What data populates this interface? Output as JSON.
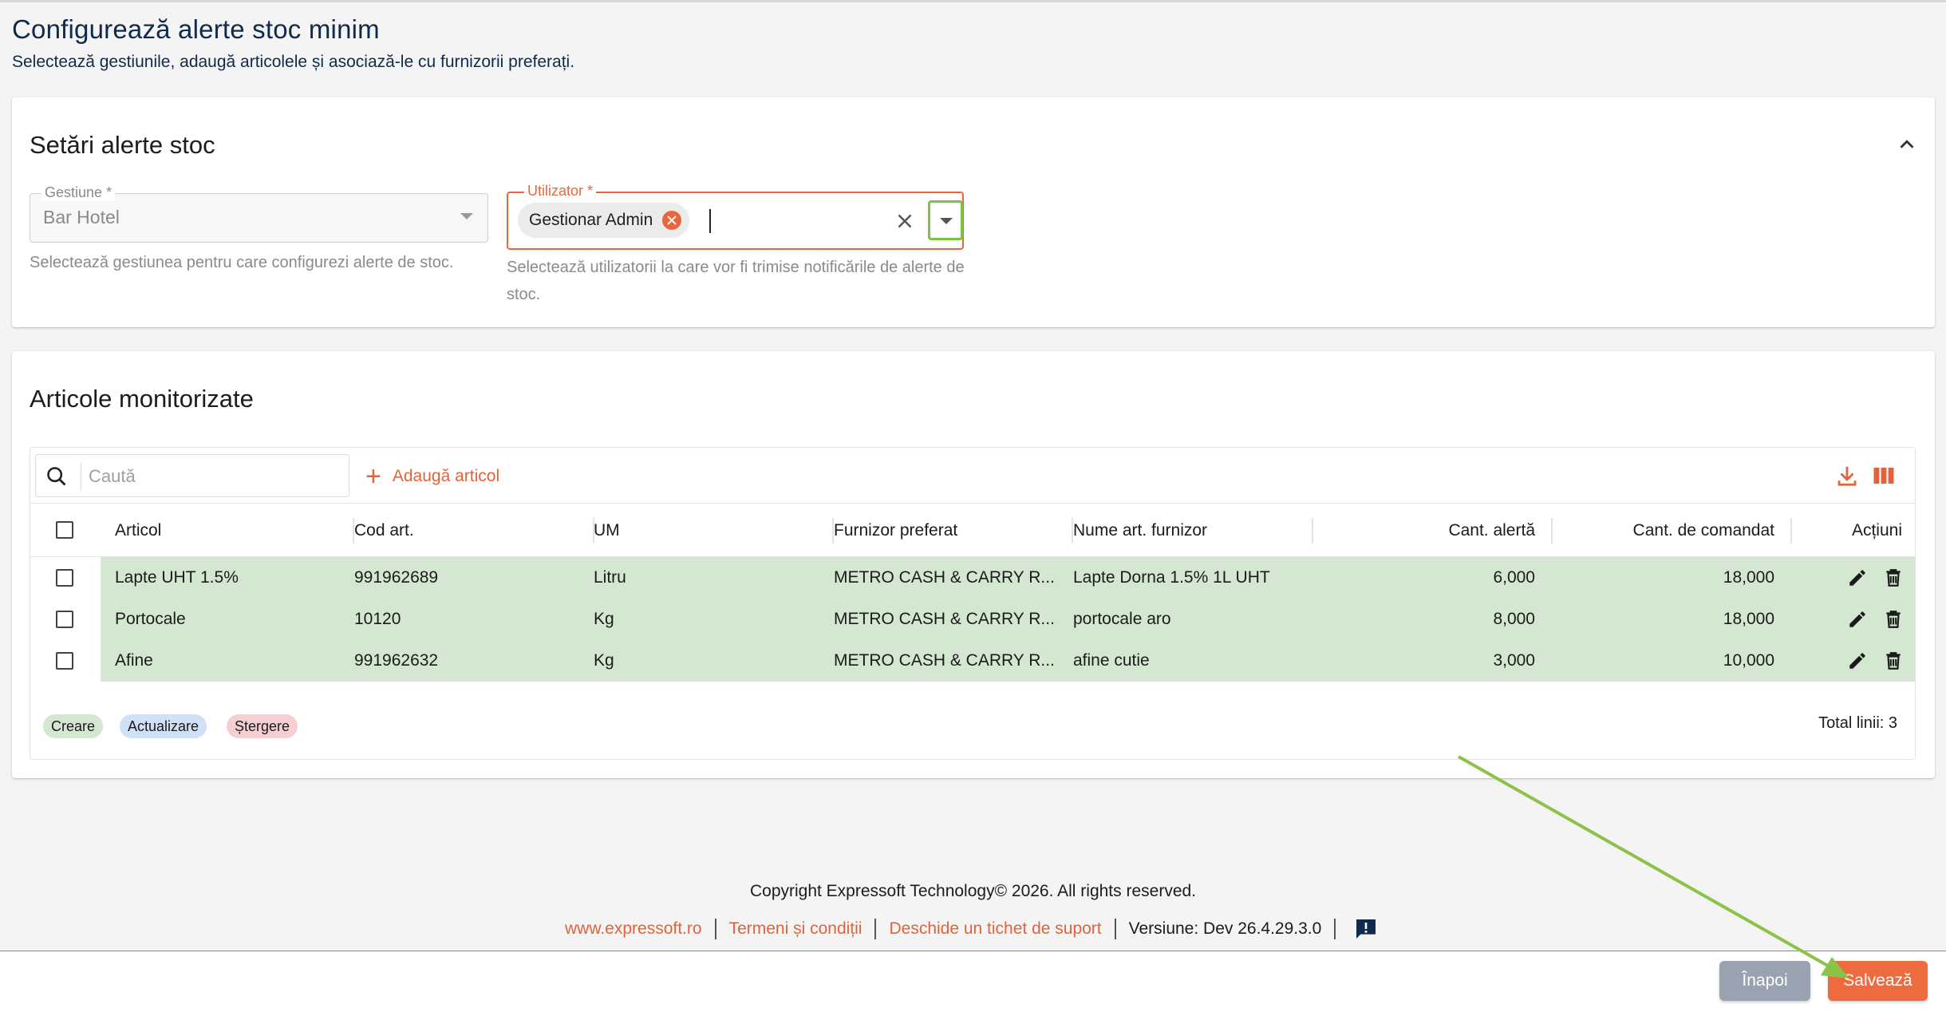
{
  "page": {
    "title": "Configurează alerte stoc minim",
    "subtitle": "Selectează gestiunile, adaugă articolele și asociază-le cu furnizorii preferați."
  },
  "settings_card": {
    "title": "Setări alerte stoc",
    "gestiune": {
      "label": "Gestiune *",
      "value": "Bar Hotel",
      "helper": "Selectează gestiunea pentru care configurezi alerte de stoc."
    },
    "utilizator": {
      "label": "Utilizator *",
      "chip": "Gestionar Admin",
      "helper": "Selectează utilizatorii la care vor fi trimise notificările de alerte de stoc."
    }
  },
  "articles_card": {
    "title": "Articole monitorizate",
    "search_placeholder": "Caută",
    "add_label": "Adaugă articol",
    "columns": [
      "Articol",
      "Cod art.",
      "UM",
      "Furnizor preferat",
      "Nume art. furnizor",
      "Cant. alertă",
      "Cant. de comandat",
      "Acțiuni"
    ],
    "rows": [
      {
        "articol": "Lapte UHT 1.5%",
        "cod": "991962689",
        "um": "Litru",
        "furnizor": "METRO CASH & CARRY R...",
        "nume_furnizor": "Lapte Dorna 1.5% 1L UHT",
        "cant_alerta": "6,000",
        "cant_comanda": "18,000"
      },
      {
        "articol": "Portocale",
        "cod": "10120",
        "um": "Kg",
        "furnizor": "METRO CASH & CARRY R...",
        "nume_furnizor": "portocale aro",
        "cant_alerta": "8,000",
        "cant_comanda": "18,000"
      },
      {
        "articol": "Afine",
        "cod": "991962632",
        "um": "Kg",
        "furnizor": "METRO CASH & CARRY R...",
        "nume_furnizor": "afine cutie",
        "cant_alerta": "3,000",
        "cant_comanda": "10,000"
      }
    ],
    "legend": [
      {
        "label": "Creare",
        "color": "#d4e7d0"
      },
      {
        "label": "Actualizare",
        "color": "#cfe0f7"
      },
      {
        "label": "Ștergere",
        "color": "#f6d0d0"
      }
    ],
    "total": "Total linii: 3"
  },
  "footer": {
    "copyright": "Copyright Expressoft Technology© 2026. All rights reserved.",
    "link_site": "www.expressoft.ro",
    "link_terms": "Termeni și condiții",
    "link_ticket": "Deschide un tichet de suport",
    "version": "Versiune: Dev 26.4.29.3.0"
  },
  "actions": {
    "back_label": "Înapoi",
    "save_label": "Salvează"
  },
  "colors": {
    "accent": "#e8673c",
    "highlight": "#7ec242",
    "row_created": "#d4e7d0",
    "title": "#0f2a4a"
  }
}
